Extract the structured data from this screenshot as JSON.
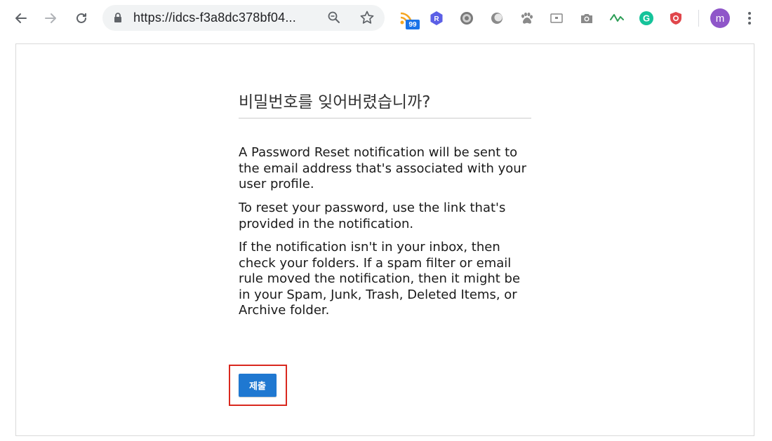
{
  "browser": {
    "url": "https://idcs-f3a8dc378bf04...",
    "extension_badge": "99",
    "profile_initial": "m",
    "icons": {
      "back": "back-arrow-icon",
      "forward": "forward-arrow-icon",
      "reload": "reload-icon",
      "lock": "lock-icon",
      "zoom": "zoom-icon",
      "star": "bookmark-star-icon",
      "menu": "kebab-menu-icon"
    },
    "extensions": [
      "rss-extension-icon",
      "r-extension-icon",
      "gear-extension-icon",
      "circle-extension-icon",
      "paw-extension-icon",
      "page-extension-icon",
      "camera-extension-icon",
      "tick-extension-icon",
      "grammarly-extension-icon",
      "shield-extension-icon"
    ]
  },
  "page": {
    "title": "비밀번호를 잊어버렸습니까?",
    "paragraphs": [
      "A Password Reset notification will be sent to the email address that's associated with your user profile.",
      "To reset your password, use the link that's provided in the notification.",
      "If the notification isn't in your inbox, then check your folders. If a spam filter or email rule moved the notification, then it might be in your Spam, Junk, Trash, Deleted Items, or Archive folder."
    ],
    "submit_label": "제출"
  },
  "colors": {
    "primary_button": "#1f78d1",
    "highlight_border": "#d9281e",
    "avatar": "#8f56c9"
  }
}
